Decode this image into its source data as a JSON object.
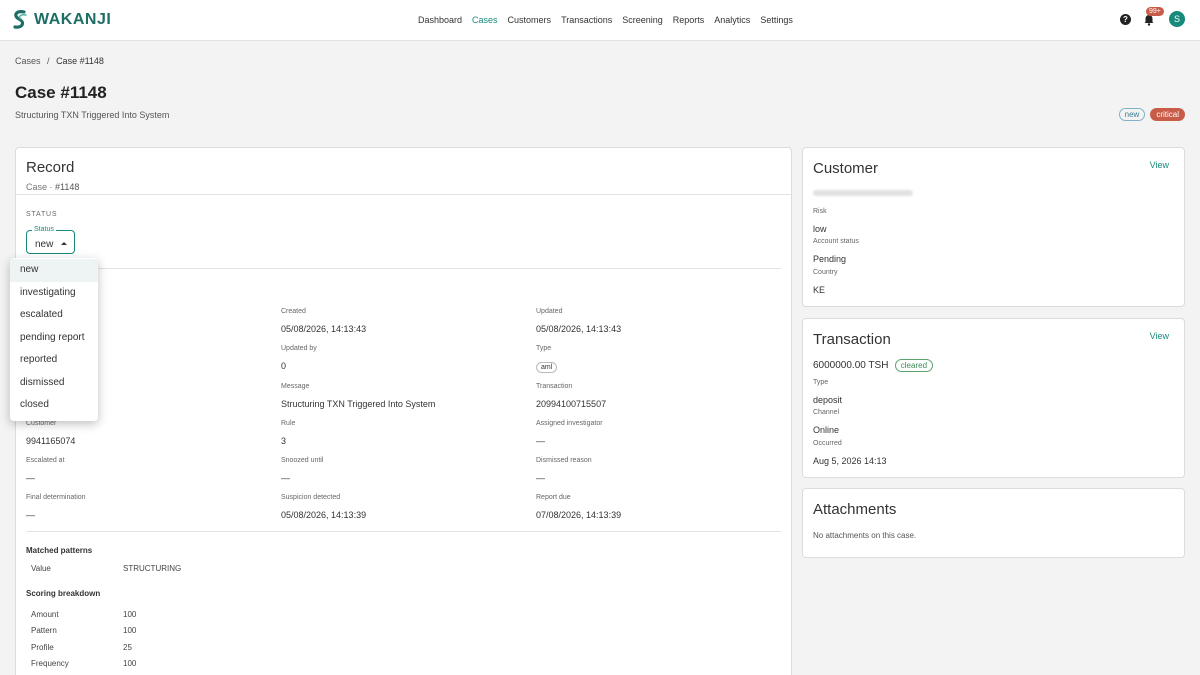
{
  "app": {
    "brand": "WAKANJI",
    "notification_count": "99+",
    "user_initial": "S"
  },
  "nav": [
    "Dashboard",
    "Cases",
    "Customers",
    "Transactions",
    "Screening",
    "Reports",
    "Analytics",
    "Settings"
  ],
  "nav_active": "Cases",
  "breadcrumb": {
    "parent": "Cases",
    "separator": "/",
    "current": "Case #1148"
  },
  "page": {
    "title": "Case #1148",
    "subtitle": "Structuring TXN Triggered Into System",
    "badge_status": "new",
    "badge_severity": "critical"
  },
  "record": {
    "title": "Record",
    "subtitle_prefix": "Case",
    "subtitle_sep": "·",
    "subtitle_id": "#1148",
    "status_section": "STATUS",
    "status_legend": "Status",
    "status_value": "new",
    "status_options": [
      "new",
      "investigating",
      "escalated",
      "pending report",
      "reported",
      "dismissed",
      "closed"
    ],
    "fields": {
      "created": {
        "label": "Created",
        "value": "05/08/2026, 14:13:43"
      },
      "updated": {
        "label": "Updated",
        "value": "05/08/2026, 14:13:43"
      },
      "updated_by": {
        "label": "Updated by",
        "value": "0"
      },
      "type": {
        "label": "Type",
        "value": "aml"
      },
      "message": {
        "label": "Message",
        "value": "Structuring TXN Triggered Into System"
      },
      "transaction": {
        "label": "Transaction",
        "value": "20994100715507"
      },
      "customer": {
        "label": "Customer",
        "value": "9941165074"
      },
      "rule": {
        "label": "Rule",
        "value": "3"
      },
      "assigned": {
        "label": "Assigned investigator",
        "value": "—"
      },
      "escalated_at": {
        "label": "Escalated at",
        "value": "—"
      },
      "snoozed": {
        "label": "Snoozed until",
        "value": "—"
      },
      "dismissed_reason": {
        "label": "Dismissed reason",
        "value": "—"
      },
      "final": {
        "label": "Final determination",
        "value": "—"
      },
      "suspicion": {
        "label": "Suspicion detected",
        "value": "05/08/2026, 14:13:39"
      },
      "report_due": {
        "label": "Report due",
        "value": "07/08/2026, 14:13:39"
      }
    },
    "matched_patterns": {
      "title": "Matched patterns",
      "key": "Value",
      "value": "STRUCTURING"
    },
    "scoring": {
      "title": "Scoring breakdown",
      "rows": [
        {
          "key": "Amount",
          "value": "100"
        },
        {
          "key": "Pattern",
          "value": "100"
        },
        {
          "key": "Profile",
          "value": "25"
        },
        {
          "key": "Frequency",
          "value": "100"
        }
      ]
    }
  },
  "customer": {
    "title": "Customer",
    "view_label": "View",
    "risk_label": "Risk",
    "risk_value": "low",
    "account_label": "Account status",
    "account_value": "Pending",
    "country_label": "Country",
    "country_value": "KE"
  },
  "transaction": {
    "title": "Transaction",
    "view_label": "View",
    "amount": "6000000.00 TSH",
    "status_badge": "cleared",
    "type_label": "Type",
    "type_value": "deposit",
    "channel_label": "Channel",
    "channel_value": "Online",
    "occurred_label": "Occurred",
    "occurred_value": "Aug 5, 2026 14:13"
  },
  "attachments": {
    "title": "Attachments",
    "empty_text": "No attachments on this case."
  },
  "colors": {
    "accent": "#178a7c",
    "critical": "#c85c48",
    "cleared": "#5ca26f"
  }
}
